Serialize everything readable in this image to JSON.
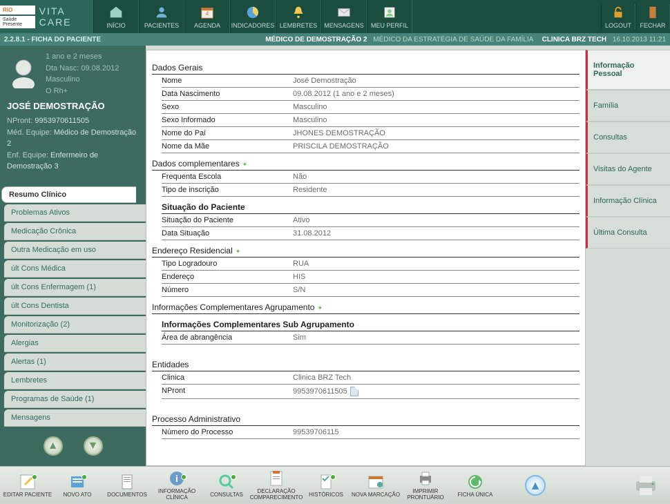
{
  "header": {
    "logo_prefix": "RIO",
    "logo_sub": "Saúde Presente",
    "product": "VITA CARE",
    "nav": [
      {
        "label": "INÍCIO",
        "icon": "home"
      },
      {
        "label": "PACIENTES",
        "icon": "users"
      },
      {
        "label": "AGENDA",
        "icon": "calendar"
      },
      {
        "label": "INDICADORES",
        "icon": "chart"
      },
      {
        "label": "LEMBRETES",
        "icon": "bell"
      },
      {
        "label": "MENSAGENS",
        "icon": "mail"
      },
      {
        "label": "MEU PERFIL",
        "icon": "profile"
      }
    ],
    "nav_right": [
      {
        "label": "LOGOUT",
        "icon": "lock"
      },
      {
        "label": "FECHAR",
        "icon": "door"
      }
    ]
  },
  "breadcrumb": {
    "code": "2.2.8.1",
    "page": "FICHA DO PACIENTE",
    "doctor": "MÉDICO DE DEMOSTRAÇÃO 2",
    "team": "MÉDICO DA ESTRATÉGIA DE SAÚDE DA FAMÍLIA",
    "clinic": "CLINICA BRZ TECH",
    "timestamp": "16.10.2013 11:21"
  },
  "patient": {
    "age": "1 ano e 2 meses",
    "dob_label": "Dta Nasc: 09.08.2012",
    "sex": "Masculino",
    "blood": "O Rh+",
    "name": "JOSÉ DEMOSTRAÇÃO",
    "npront_label": "NPront:",
    "npront": "9953970611505",
    "med_team_label": "Méd. Equipe:",
    "med_team": "Médico de Demostração 2",
    "enf_team_label": "Enf. Equipe:",
    "enf_team": "Enfermeiro de Demostração 3"
  },
  "left_tabs": [
    "Resumo Clínico",
    "Problemas Ativos",
    "Medicação Crônica",
    "Outra Medicação em uso",
    "últ Cons Médica",
    "últ Cons Enfermagem (1)",
    "últ Cons Dentista",
    "Monitorização (2)",
    "Alergias",
    "Alertas (1)",
    "Lembretes",
    "Programas de Saúde (1)",
    "Mensagens"
  ],
  "right_tabs": [
    "Informação Pessoal",
    "Família",
    "Consultas",
    "Visitas do Agente",
    "Informação Clínica",
    "Última Consulta"
  ],
  "sections": {
    "dados_gerais": {
      "title": "Dados Gerais",
      "rows": [
        {
          "label": "Nome",
          "value": "José Demostração"
        },
        {
          "label": "Data Nascimento",
          "value": "09.08.2012 (1 ano e 2 meses)"
        },
        {
          "label": "Sexo",
          "value": "Masculino"
        },
        {
          "label": "Sexo Informado",
          "value": "Masculino"
        },
        {
          "label": "Nome do Pai",
          "value": "JHONES DEMOSTRAÇÃO"
        },
        {
          "label": "Nome da Mãe",
          "value": "PRISCILA DEMOSTRAÇÃO"
        }
      ]
    },
    "dados_compl": {
      "title": "Dados complementares",
      "rows": [
        {
          "label": "Frequenta Escola",
          "value": "Não"
        },
        {
          "label": "Tipo de inscrição",
          "value": "Residente"
        }
      ],
      "subsection": {
        "title": "Situação do Paciente",
        "rows": [
          {
            "label": "Situação do Paciente",
            "value": "Ativo"
          },
          {
            "label": "Data Situação",
            "value": "31.08.2012"
          }
        ]
      }
    },
    "endereco": {
      "title": "Endereço Residencial",
      "rows": [
        {
          "label": "Tipo Logradouro",
          "value": "RUA"
        },
        {
          "label": "Endereço",
          "value": "HIS"
        },
        {
          "label": "Número",
          "value": "S/N"
        }
      ]
    },
    "info_compl": {
      "title": "Informações Complementares Agrupamento",
      "sub_title": "Informações Complementares Sub Agrupamento",
      "rows": [
        {
          "label": "Área de abrangência",
          "value": "Sim"
        }
      ]
    },
    "entidades": {
      "title": "Entidades",
      "rows": [
        {
          "label": "Clinica",
          "value": "Clinica BRZ Tech"
        },
        {
          "label": "NPront",
          "value": "9953970611505",
          "icon": true
        }
      ]
    },
    "processo": {
      "title": "Processo Administrativo",
      "rows": [
        {
          "label": "Número do Processo",
          "value": "99539706115"
        }
      ]
    }
  },
  "toolbar": [
    {
      "label": "EDITAR PACIENTE",
      "icon": "edit",
      "badge": true
    },
    {
      "label": "NOVO ATO",
      "icon": "new",
      "badge": true
    },
    {
      "label": "DOCUMENTOS",
      "icon": "doc"
    },
    {
      "label": "INFORMAÇÃO CLÍNICA",
      "icon": "info",
      "badge": true
    },
    {
      "label": "CONSULTAS",
      "icon": "search",
      "badge": true
    },
    {
      "label": "DECLARAÇÃO COMPARECIMENTO",
      "icon": "decl"
    },
    {
      "label": "HISTÓRICOS",
      "icon": "hist",
      "badge": true
    },
    {
      "label": "NOVA MARCAÇÃO",
      "icon": "mark"
    },
    {
      "label": "IMPRIMIR PRONTUÁRIO",
      "icon": "print"
    },
    {
      "label": "FICHA ÚNICA",
      "icon": "ficha"
    }
  ]
}
